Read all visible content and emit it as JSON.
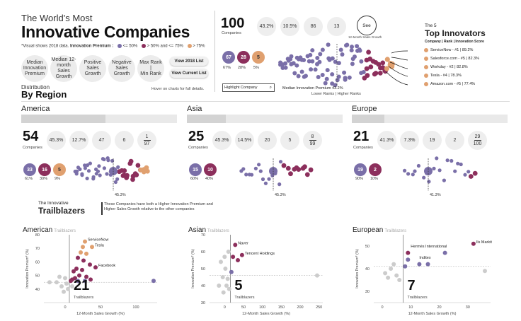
{
  "header": {
    "supertitle": "The World's Most",
    "title": "Innovative Companies",
    "subline_prefix": "*Visual shows 2018 data.",
    "subline_bold": "Innovation Premium :",
    "legend_low": "<= 50%",
    "legend_mid": "> 50% and <= 75%",
    "legend_high": "> 75%",
    "hover_note": "Hover on charts for full details."
  },
  "filters": [
    "Median Innovation Premium",
    "Median 12-month Sales Growth",
    "Positive Sales Growth",
    "Negative Sales Growth",
    "Max Rank\n|\nMin Rank"
  ],
  "buttons": {
    "view2018": "View 2018 List",
    "current": "View Current List"
  },
  "distribution": {
    "small": "Distribution",
    "big": "By Region"
  },
  "search": {
    "placeholder": "Highlight Company"
  },
  "overall": {
    "count": "100",
    "count_label": "Companies",
    "stats": [
      "43.2%",
      "10.5%",
      "86",
      "13"
    ],
    "see": "See",
    "see_label": "12-Month Sales Growth",
    "badges": [
      "67",
      "28",
      "5"
    ],
    "badge_pcts": [
      "67%",
      "28%",
      "5%"
    ],
    "median_label": "Median Innovation Premium",
    "median_value": "43.2%",
    "lower": "Lower Ranks",
    "higher": "Higher Ranks"
  },
  "top": {
    "small": "The 5",
    "big": "Top Innovators",
    "sub": "Company | Rank | Innovation Score",
    "items": [
      "ServiceNow - #1 | 89.2%",
      "Salesforce.com - #5 | 82.3%",
      "Workday - #2 | 82.8%",
      "Tesla - #4 | 78.3%",
      "Amazon.com - #5 | 77.4%"
    ]
  },
  "regions": [
    {
      "name": "America",
      "count": "54",
      "label": "Companies",
      "stats": [
        "45.3%",
        "12.7%",
        "47",
        "6"
      ],
      "frac_top": "1",
      "frac_bot": "97",
      "badges": [
        "33",
        "16",
        "5"
      ],
      "pcts": [
        "61%",
        "30%",
        "9%"
      ],
      "median": "45.3%",
      "fill": 0.54
    },
    {
      "name": "Asia",
      "count": "25",
      "label": "Companies",
      "stats": [
        "45.3%",
        "14.5%",
        "20",
        "5"
      ],
      "frac_top": "8",
      "frac_bot": "99",
      "badges": [
        "15",
        "10"
      ],
      "pcts": [
        "60%",
        "40%"
      ],
      "median": "45.3%",
      "fill": 0.25
    },
    {
      "name": "Europe",
      "count": "21",
      "label": "Companies",
      "stats": [
        "41.3%",
        "7.3%",
        "19",
        "2"
      ],
      "frac_top": "29",
      "frac_bot": "100",
      "badges": [
        "19",
        "2"
      ],
      "pcts": [
        "90%",
        "10%"
      ],
      "median": "41.3%",
      "fill": 0.21
    }
  ],
  "trail": {
    "small": "The Innovative",
    "big": "Trailblazers",
    "desc": "These Companies have both a Higher Innovation Premium and Higher Sales Growth relative to the other companies"
  },
  "colors": {
    "low": "#7a6fa8",
    "mid": "#8c2f5c",
    "high": "#e0a06f",
    "grey": "#cccccc",
    "text": "#222222"
  },
  "chart_data": [
    {
      "type": "scatter",
      "title": "American",
      "subtitle": "Trailblazers",
      "xlabel": "12-Month Sales Growth (%)",
      "ylabel": "Innovation Premium* (%)",
      "xlim": [
        -30,
        130
      ],
      "ylim": [
        30,
        80
      ],
      "xticks": [
        0,
        50,
        100
      ],
      "yticks": [
        40,
        50,
        60,
        70,
        80
      ],
      "count": "21",
      "count_label": "Trailblazers",
      "median_x": 6,
      "median_y": 45,
      "annotations": [
        {
          "text": "ServiceNow",
          "x": 28,
          "y": 75
        },
        {
          "text": "Tesla",
          "x": 38,
          "y": 71
        },
        {
          "text": "Facebook",
          "x": 43,
          "y": 56
        }
      ],
      "points": [
        {
          "x": 28,
          "y": 75,
          "c": "high"
        },
        {
          "x": 38,
          "y": 71,
          "c": "high"
        },
        {
          "x": 25,
          "y": 71,
          "c": "high"
        },
        {
          "x": 22,
          "y": 67,
          "c": "high"
        },
        {
          "x": 30,
          "y": 66,
          "c": "high"
        },
        {
          "x": 18,
          "y": 63,
          "c": "mid"
        },
        {
          "x": 26,
          "y": 61,
          "c": "mid"
        },
        {
          "x": 35,
          "y": 58,
          "c": "mid"
        },
        {
          "x": 43,
          "y": 56,
          "c": "mid"
        },
        {
          "x": 16,
          "y": 55,
          "c": "mid"
        },
        {
          "x": 24,
          "y": 54,
          "c": "mid"
        },
        {
          "x": 12,
          "y": 53,
          "c": "mid"
        },
        {
          "x": 20,
          "y": 50,
          "c": "mid"
        },
        {
          "x": 30,
          "y": 49,
          "c": "mid"
        },
        {
          "x": 14,
          "y": 48,
          "c": "mid"
        },
        {
          "x": 10,
          "y": 47,
          "c": "mid"
        },
        {
          "x": 28,
          "y": 46,
          "c": "low"
        },
        {
          "x": 18,
          "y": 46,
          "c": "low"
        },
        {
          "x": 125,
          "y": 46,
          "c": "low"
        },
        {
          "x": 8,
          "y": 46,
          "c": "mid"
        },
        {
          "x": 36,
          "y": 47,
          "c": "mid"
        },
        {
          "x": -22,
          "y": 45,
          "c": "grey"
        },
        {
          "x": -12,
          "y": 45,
          "c": "grey"
        },
        {
          "x": -5,
          "y": 42,
          "c": "grey"
        },
        {
          "x": 0,
          "y": 48,
          "c": "grey"
        },
        {
          "x": 2,
          "y": 44,
          "c": "grey"
        },
        {
          "x": -8,
          "y": 49,
          "c": "grey"
        },
        {
          "x": 4,
          "y": 40,
          "c": "grey"
        },
        {
          "x": 10,
          "y": 42,
          "c": "grey"
        },
        {
          "x": -2,
          "y": 38,
          "c": "grey"
        }
      ]
    },
    {
      "type": "scatter",
      "title": "Asian",
      "subtitle": "Trailblazers",
      "xlabel": "12-Month Sales Growth (%)",
      "ylabel": "Innovation Premium* (%)",
      "xlim": [
        -40,
        260
      ],
      "ylim": [
        30,
        70
      ],
      "xticks": [
        0,
        50,
        100,
        150,
        200,
        250
      ],
      "yticks": [
        30,
        40,
        50,
        60,
        70
      ],
      "count": "5",
      "count_label": "Trailblazers",
      "median_x": 15,
      "median_y": 46,
      "annotations": [
        {
          "text": "Naver",
          "x": 28,
          "y": 64
        },
        {
          "text": "Tencent Holdings",
          "x": 46,
          "y": 58
        }
      ],
      "points": [
        {
          "x": 28,
          "y": 64,
          "c": "mid"
        },
        {
          "x": 46,
          "y": 58,
          "c": "mid"
        },
        {
          "x": 35,
          "y": 55,
          "c": "mid"
        },
        {
          "x": 22,
          "y": 57,
          "c": "mid"
        },
        {
          "x": 18,
          "y": 48,
          "c": "low"
        },
        {
          "x": 10,
          "y": 60,
          "c": "grey"
        },
        {
          "x": 0,
          "y": 57,
          "c": "grey"
        },
        {
          "x": -10,
          "y": 54,
          "c": "grey"
        },
        {
          "x": 2,
          "y": 50,
          "c": "grey"
        },
        {
          "x": -5,
          "y": 45,
          "c": "grey"
        },
        {
          "x": 8,
          "y": 44,
          "c": "grey"
        },
        {
          "x": -15,
          "y": 40,
          "c": "grey"
        },
        {
          "x": 5,
          "y": 40,
          "c": "grey"
        },
        {
          "x": -3,
          "y": 36,
          "c": "grey"
        },
        {
          "x": 12,
          "y": 38,
          "c": "grey"
        },
        {
          "x": 245,
          "y": 46,
          "c": "grey"
        }
      ]
    },
    {
      "type": "scatter",
      "title": "European",
      "subtitle": "Trailblazers",
      "xlabel": "12-Month Sales Growth (%)",
      "ylabel": "Innovation Premium* (%)",
      "xlim": [
        -3,
        38
      ],
      "ylim": [
        25,
        55
      ],
      "xticks": [
        0,
        10,
        20,
        30
      ],
      "yticks": [
        30,
        40,
        50
      ],
      "count": "7",
      "count_label": "Trailblazers",
      "median_x": 7.3,
      "median_y": 41,
      "annotations": [
        {
          "text": "Hermès International",
          "x": 9,
          "y": 49
        },
        {
          "text": "Inditex",
          "x": 12,
          "y": 44
        },
        {
          "text": "Ils Markit",
          "x": 32,
          "y": 51
        }
      ],
      "points": [
        {
          "x": 9,
          "y": 47,
          "c": "mid"
        },
        {
          "x": 32,
          "y": 51,
          "c": "mid"
        },
        {
          "x": 9,
          "y": 44,
          "c": "low"
        },
        {
          "x": 13,
          "y": 42,
          "c": "low"
        },
        {
          "x": 16,
          "y": 42,
          "c": "low"
        },
        {
          "x": 22,
          "y": 47,
          "c": "low"
        },
        {
          "x": 8,
          "y": 41,
          "c": "low"
        },
        {
          "x": 1,
          "y": 38,
          "c": "grey"
        },
        {
          "x": 3,
          "y": 40,
          "c": "grey"
        },
        {
          "x": 5,
          "y": 37,
          "c": "grey"
        },
        {
          "x": 4,
          "y": 42,
          "c": "grey"
        },
        {
          "x": 6,
          "y": 35,
          "c": "grey"
        },
        {
          "x": 36,
          "y": 39,
          "c": "grey"
        },
        {
          "x": 2,
          "y": 36,
          "c": "grey"
        }
      ]
    }
  ]
}
